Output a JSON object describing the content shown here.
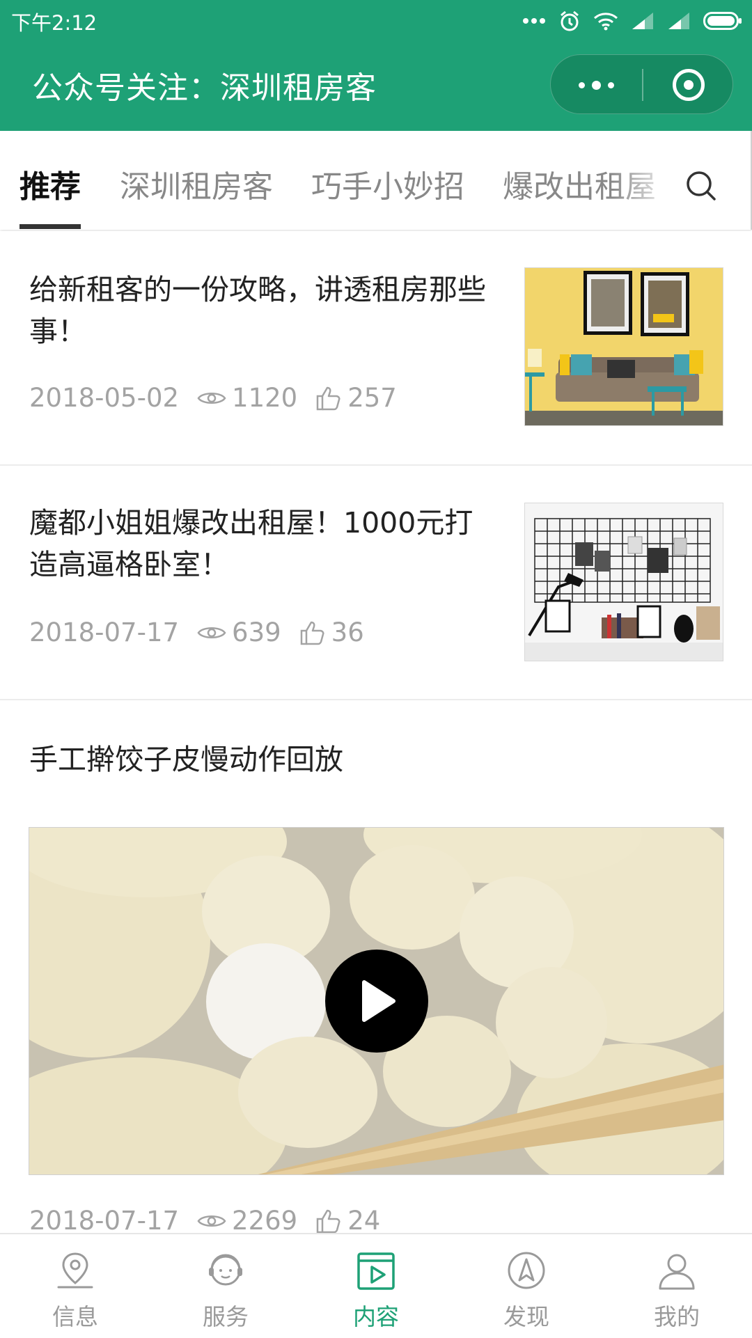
{
  "status_bar": {
    "time": "下午2:12"
  },
  "header": {
    "title": "公众号关注：深圳租房客"
  },
  "tabs": [
    {
      "label": "推荐",
      "active": true
    },
    {
      "label": "深圳租房客",
      "active": false
    },
    {
      "label": "巧手小妙招",
      "active": false
    },
    {
      "label": "爆改出租屋",
      "active": false
    }
  ],
  "articles": [
    {
      "title": "给新租客的一份攻略，讲透租房那些事！",
      "date": "2018-05-02",
      "views": "1120",
      "likes": "257"
    },
    {
      "title": "魔都小姐姐爆改出租屋！1000元打造高逼格卧室！",
      "date": "2018-07-17",
      "views": "639",
      "likes": "36"
    },
    {
      "title": "手工擀饺子皮慢动作回放",
      "date": "2018-07-17",
      "views": "2269",
      "likes": "24"
    }
  ],
  "bottom_nav": [
    {
      "label": "信息",
      "icon": "location-pin-icon",
      "active": false
    },
    {
      "label": "服务",
      "icon": "headset-service-icon",
      "active": false
    },
    {
      "label": "内容",
      "icon": "video-content-icon",
      "active": true
    },
    {
      "label": "发现",
      "icon": "compass-icon",
      "active": false
    },
    {
      "label": "我的",
      "icon": "user-profile-icon",
      "active": false
    }
  ],
  "colors": {
    "brand": "#1ea176",
    "muted": "#a3a3a3",
    "text": "#222222"
  }
}
